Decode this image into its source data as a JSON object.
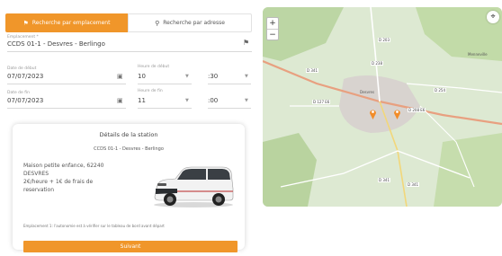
{
  "tabs": {
    "location_label": "Recherche par emplacement",
    "address_label": "Recherche par adresse"
  },
  "station_field": {
    "label": "Emplacement *",
    "value": "CCDS 01-1 - Desvres - Berlingo"
  },
  "start": {
    "date_label": "Date de début",
    "date_value": "07/07/2023",
    "time_label": "Heure de début",
    "hour_value": "10",
    "minute_value": ":30"
  },
  "end": {
    "date_label": "Date de fin",
    "date_value": "07/07/2023",
    "time_label": "Heure de fin",
    "hour_value": "11",
    "minute_value": ":00"
  },
  "station_card": {
    "title": "Détails de la station",
    "station_name": "CCDS 01-1 - Desvres - Berlingo",
    "address_line1": "Maison petite enfance, 62240",
    "address_line2": "DESVRES",
    "price_line1": "2€/heure + 1€ de frais de",
    "price_line2": "reservation",
    "note": "Emplacement 1: l'autonomie est à vérifier sur le tableau de bord avant départ"
  },
  "next_button": "Suivant",
  "map": {
    "zoom_in": "+",
    "zoom_out": "−",
    "road_labels": [
      "D 203",
      "D 341",
      "D 127 E6",
      "D 238",
      "D 254",
      "D 208 E6",
      "D 341",
      "D 341"
    ],
    "places": [
      "Menneville",
      "Desvres"
    ]
  },
  "colors": {
    "accent": "#f0962a",
    "marker": "#f28c28"
  }
}
